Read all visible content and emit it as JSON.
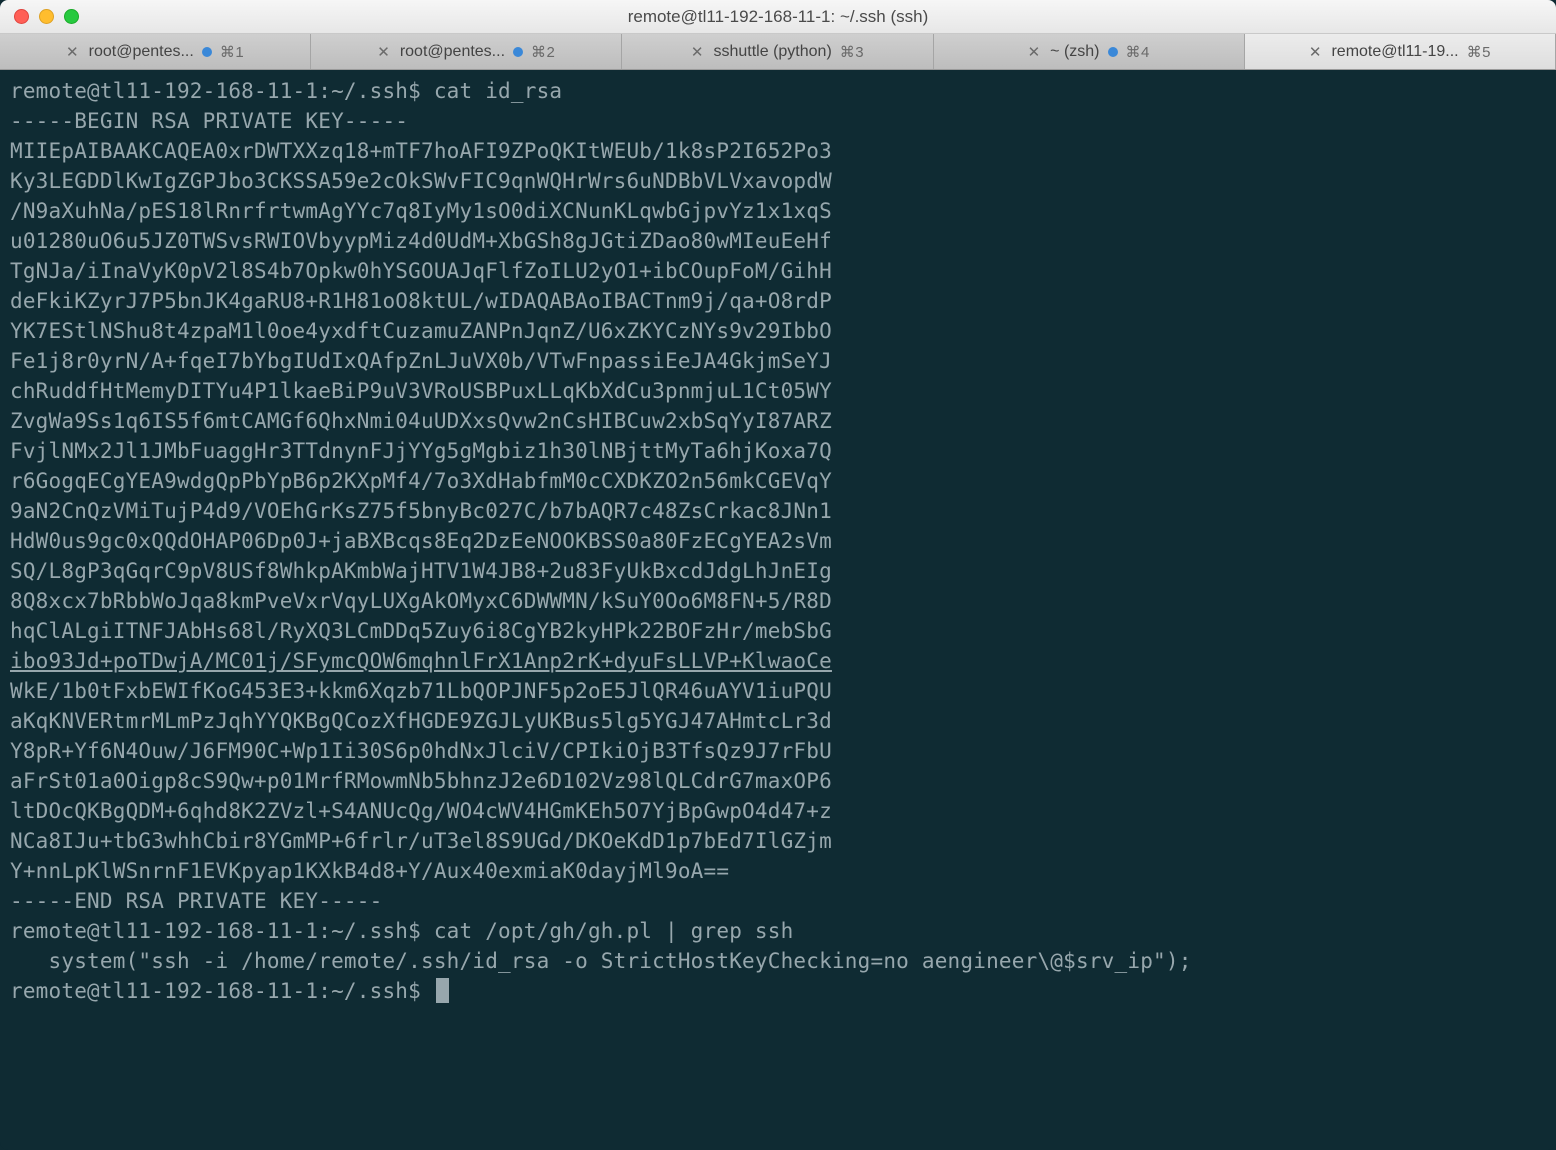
{
  "window": {
    "title": "remote@tl11-192-168-11-1: ~/.ssh (ssh)"
  },
  "tabs": [
    {
      "label": "root@pentes...",
      "status": true,
      "shortcut": "⌘1",
      "active": false
    },
    {
      "label": "root@pentes...",
      "status": true,
      "shortcut": "⌘2",
      "active": false
    },
    {
      "label": "sshuttle (python)",
      "status": false,
      "shortcut": "⌘3",
      "active": false
    },
    {
      "label": "~ (zsh)",
      "status": true,
      "shortcut": "⌘4",
      "active": false
    },
    {
      "label": "remote@tl11-19...",
      "status": false,
      "shortcut": "⌘5",
      "active": true
    }
  ],
  "terminal": {
    "lines": [
      {
        "text": "remote@tl11-192-168-11-1:~/.ssh$ cat id_rsa"
      },
      {
        "text": "-----BEGIN RSA PRIVATE KEY-----"
      },
      {
        "text": "MIIEpAIBAAKCAQEA0xrDWTXXzq18+mTF7hoAFI9ZPoQKItWEUb/1k8sP2I652Po3"
      },
      {
        "text": "Ky3LEGDDlKwIgZGPJbo3CKSSA59e2cOkSWvFIC9qnWQHrWrs6uNDBbVLVxavopdW"
      },
      {
        "text": "/N9aXuhNa/pES18lRnrfrtwmAgYYc7q8IyMy1sO0diXCNunKLqwbGjpvYz1x1xqS"
      },
      {
        "text": "u01280uO6u5JZ0TWSvsRWIOVbyypMiz4d0UdM+XbGSh8gJGtiZDao80wMIeuEeHf"
      },
      {
        "text": "TgNJa/iInaVyK0pV2l8S4b7Opkw0hYSGOUAJqFlfZoILU2yO1+ibCOupFoM/GihH"
      },
      {
        "text": "deFkiKZyrJ7P5bnJK4gaRU8+R1H81oO8ktUL/wIDAQABAoIBACTnm9j/qa+O8rdP"
      },
      {
        "text": "YK7EStlNShu8t4zpaM1l0oe4yxdftCuzamuZANPnJqnZ/U6xZKYCzNYs9v29IbbO"
      },
      {
        "text": "Fe1j8r0yrN/A+fqeI7bYbgIUdIxQAfpZnLJuVX0b/VTwFnpassiEeJA4GkjmSeYJ"
      },
      {
        "text": "chRuddfHtMemyDITYu4P1lkaeBiP9uV3VRoUSBPuxLLqKbXdCu3pnmjuL1Ct05WY"
      },
      {
        "text": "ZvgWa9Ss1q6IS5f6mtCAMGf6QhxNmi04uUDXxsQvw2nCsHIBCuw2xbSqYyI87ARZ"
      },
      {
        "text": "FvjlNMx2Jl1JMbFuaggHr3TTdnynFJjYYg5gMgbiz1h30lNBjttMyTa6hjKoxa7Q"
      },
      {
        "text": "r6GogqECgYEA9wdgQpPbYpB6p2KXpMf4/7o3XdHabfmM0cCXDKZO2n56mkCGEVqY"
      },
      {
        "text": "9aN2CnQzVMiTujP4d9/VOEhGrKsZ75f5bnyBc027C/b7bAQR7c48ZsCrkac8JNn1"
      },
      {
        "text": "HdW0us9gc0xQQdOHAP06Dp0J+jaBXBcqs8Eq2DzEeNOOKBSS0a80FzECgYEA2sVm"
      },
      {
        "text": "SQ/L8gP3qGqrC9pV8USf8WhkpAKmbWajHTV1W4JB8+2u83FyUkBxcdJdgLhJnEIg"
      },
      {
        "text": "8Q8xcx7bRbbWoJqa8kmPveVxrVqyLUXgAkOMyxC6DWWMN/kSuY0Oo6M8FN+5/R8D"
      },
      {
        "text": "hqClALgiITNFJAbHs68l/RyXQ3LCmDDq5Zuy6i8CgYB2kyHPk22BOFzHr/mebSbG"
      },
      {
        "text": "ibo93Jd+poTDwjA/MC01j/SFymcQOW6mqhnlFrX1Anp2rK+dyuFsLLVP+KlwaoCe",
        "underlined": true
      },
      {
        "text": "WkE/1b0tFxbEWIfKoG453E3+kkm6Xqzb71LbQOPJNF5p2oE5JlQR46uAYV1iuPQU"
      },
      {
        "text": "aKqKNVERtmrMLmPzJqhYYQKBgQCozXfHGDE9ZGJLyUKBus5lg5YGJ47AHmtcLr3d"
      },
      {
        "text": "Y8pR+Yf6N4Ouw/J6FM90C+Wp1Ii30S6p0hdNxJlciV/CPIkiOjB3TfsQz9J7rFbU"
      },
      {
        "text": "aFrSt01a0Oigp8cS9Qw+p01MrfRMowmNb5bhnzJ2e6D102Vz98lQLCdrG7maxOP6"
      },
      {
        "text": "ltDOcQKBgQDM+6qhd8K2ZVzl+S4ANUcQg/WO4cWV4HGmKEh5O7YjBpGwpO4d47+z"
      },
      {
        "text": "NCa8IJu+tbG3whhCbir8YGmMP+6frlr/uT3el8S9UGd/DKOeKdD1p7bEd7IlGZjm"
      },
      {
        "text": "Y+nnLpKlWSnrnF1EVKpyap1KXkB4d8+Y/Aux40exmiaK0dayjMl9oA=="
      },
      {
        "text": "-----END RSA PRIVATE KEY-----"
      },
      {
        "text": "remote@tl11-192-168-11-1:~/.ssh$ cat /opt/gh/gh.pl | grep ssh"
      },
      {
        "text": "   system(\"ssh -i /home/remote/.ssh/id_rsa -o StrictHostKeyChecking=no aengineer\\@$srv_ip\");"
      },
      {
        "text": "remote@tl11-192-168-11-1:~/.ssh$ ",
        "cursor": true
      }
    ]
  }
}
